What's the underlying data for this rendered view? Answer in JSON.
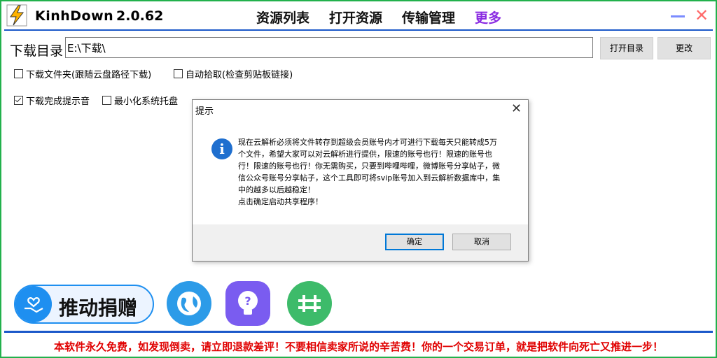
{
  "app": {
    "name": "KinhDown",
    "version": "2.0.62"
  },
  "nav": {
    "resources": "资源列表",
    "open": "打开资源",
    "transfers": "传输管理",
    "more": "更多"
  },
  "download_dir": {
    "label": "下载目录",
    "value": "E:\\下载\\",
    "open_button": "打开目录",
    "change_button": "更改"
  },
  "options": {
    "follow_folder": {
      "label": "下载文件夹(跟随云盘路径下载)",
      "checked": false
    },
    "auto_pickup": {
      "label": "自动拾取(检查剪贴板链接)",
      "checked": false
    },
    "notify_sound": {
      "label": "下载完成提示音",
      "checked": true
    },
    "minimize_tray": {
      "label": "最小化系统托盘",
      "checked": false
    }
  },
  "dialog": {
    "title": "提示",
    "message_lines": [
      "现在云解析必须将文件转存到超级会员账号内才可进行下载每天只能转成5万",
      "个文件，希望大家可以对云解析进行提供，限速的账号也行！限速的账号也",
      "行！限速的账号也行！你无需购买，只要到哔哩哔哩，微博账号分享帖子，微",
      "信公众号账号分享帖子，这个工具即可将svip账号加入到云解析数据库中，集",
      "中的越多以后越稳定！",
      "点击确定启动共享程序！"
    ],
    "ok": "确定",
    "cancel": "取消"
  },
  "donate": {
    "label": "推动捐赠"
  },
  "icons": [
    "lightning-logo-icon",
    "globe-icon",
    "help-bulb-icon",
    "community-icon"
  ],
  "notice": "本软件永久免费，如发现倒卖，请立即退款差评！不要相信卖家所说的辛苦费！你的一个交易订单，就是把软件向死亡又推进一步！",
  "colors": {
    "accent_blue": "#1b58c9",
    "frame_green": "#22b14c",
    "more_purple": "#8a2be2",
    "notice_red": "#e00000",
    "close_red": "#ff6b6b"
  }
}
